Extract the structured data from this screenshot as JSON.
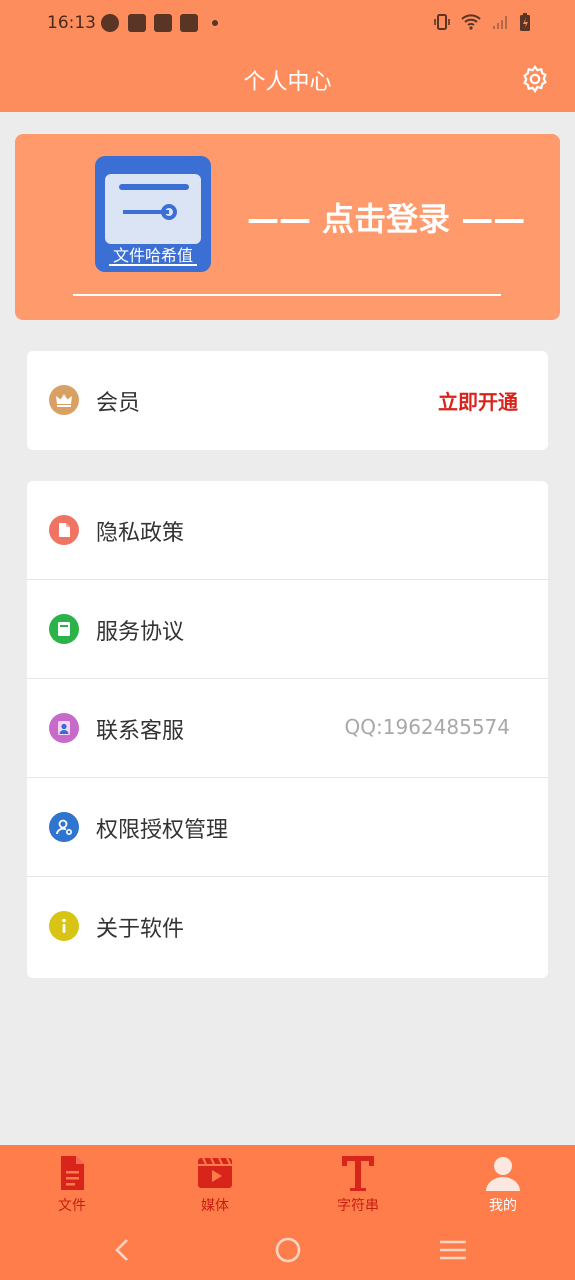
{
  "status": {
    "time": "16:13"
  },
  "header": {
    "title": "个人中心"
  },
  "hero": {
    "logo_label": "文件哈希值",
    "login_text": "—— 点击登录 ——"
  },
  "vip": {
    "label": "会员",
    "action": "立即开通",
    "icon": "crown-icon"
  },
  "menu": [
    {
      "label": "隐私政策",
      "icon": "document-icon",
      "color": "#ef7462",
      "extra": ""
    },
    {
      "label": "服务协议",
      "icon": "book-icon",
      "color": "#2bb34a",
      "extra": ""
    },
    {
      "label": "联系客服",
      "icon": "user-icon",
      "color": "#c86ac9",
      "extra": "QQ:1962485574"
    },
    {
      "label": "权限授权管理",
      "icon": "person-gear-icon",
      "color": "#2f74cf",
      "extra": ""
    },
    {
      "label": "关于软件",
      "icon": "info-icon",
      "color": "#d8c414",
      "extra": ""
    }
  ],
  "tabs": [
    {
      "label": "文件",
      "icon": "file-icon"
    },
    {
      "label": "媒体",
      "icon": "video-icon"
    },
    {
      "label": "字符串",
      "icon": "text-icon"
    },
    {
      "label": "我的",
      "icon": "person-icon"
    }
  ],
  "colors": {
    "brand": "#fe8d5e",
    "tabbar": "#fe7d4a",
    "accent_red": "#d8241b"
  }
}
